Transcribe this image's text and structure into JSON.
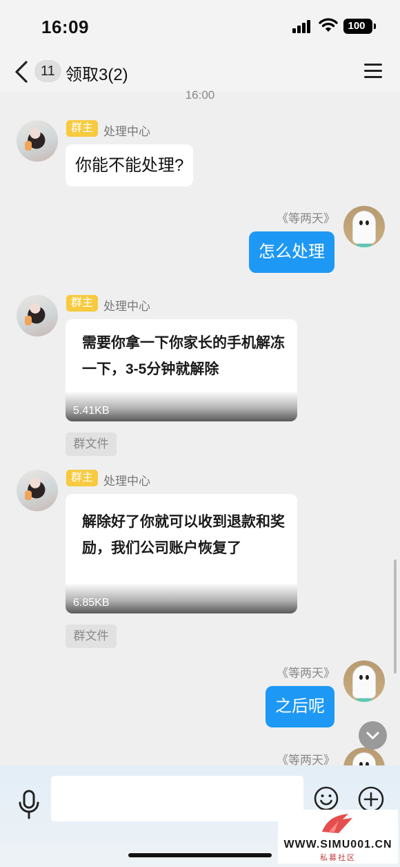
{
  "status_bar": {
    "time": "16:09",
    "battery": "100"
  },
  "header": {
    "unread_count": "11",
    "title": "领取3(2)"
  },
  "timestamp": "16:00",
  "messages": [
    {
      "side": "left",
      "badge": "群主",
      "sender": "处理中心",
      "text": "你能不能处理?"
    },
    {
      "side": "right",
      "sender": "《等两天》",
      "text": "怎么处理"
    },
    {
      "side": "left",
      "badge": "群主",
      "sender": "处理中心",
      "file_text": "需要你拿一下你家长的手机解冻一下，3-5分钟就解除",
      "file_size": "5.41KB",
      "file_tag": "群文件"
    },
    {
      "side": "left",
      "badge": "群主",
      "sender": "处理中心",
      "file_text": "解除好了你就可以收到退款和奖励，我们公司账户恢复了",
      "file_size": "6.85KB",
      "file_tag": "群文件"
    },
    {
      "side": "right",
      "sender": "《等两天》",
      "text": "之后呢"
    },
    {
      "side": "right",
      "sender": "《等两天》"
    }
  ],
  "watermark": {
    "url": "WWW.SIMU001.CN",
    "subtitle": "私募社区"
  },
  "colors": {
    "accent_blue": "#1e98f5",
    "badge_yellow": "#f7ca3f"
  },
  "icons": [
    "back-icon",
    "menu-icon",
    "mic-icon",
    "emoji-icon",
    "plus-icon",
    "scroll-down-icon",
    "signal-icon",
    "wifi-icon",
    "battery-icon"
  ]
}
